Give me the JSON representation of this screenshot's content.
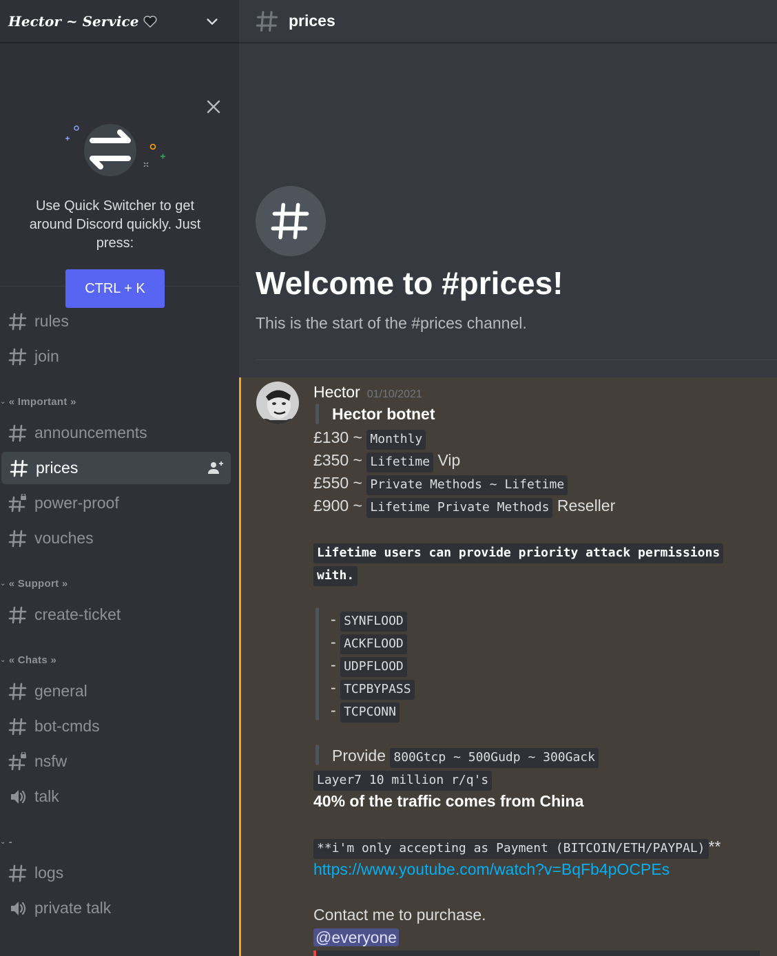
{
  "server": {
    "name": "Hector ~ Service"
  },
  "quick_switcher": {
    "text": "Use Quick Switcher to get around Discord quickly. Just press:",
    "button": "CTRL + K"
  },
  "channels": {
    "top": [
      {
        "name": "rules",
        "icon": "hash-icon"
      },
      {
        "name": "join",
        "icon": "hash-icon"
      }
    ],
    "important": {
      "label": "« Important »",
      "items": [
        {
          "name": "announcements",
          "icon": "hash-icon"
        },
        {
          "name": "prices",
          "icon": "hash-icon",
          "active": true
        },
        {
          "name": "power-proof",
          "icon": "hash-locked-icon"
        },
        {
          "name": "vouches",
          "icon": "hash-icon"
        }
      ]
    },
    "support": {
      "label": "« Support »",
      "items": [
        {
          "name": "create-ticket",
          "icon": "hash-icon"
        }
      ]
    },
    "chats": {
      "label": "« Chats »",
      "items": [
        {
          "name": "general",
          "icon": "hash-icon"
        },
        {
          "name": "bot-cmds",
          "icon": "hash-icon"
        },
        {
          "name": "nsfw",
          "icon": "hash-locked-icon"
        },
        {
          "name": "talk",
          "icon": "speaker-icon"
        }
      ]
    },
    "misc": {
      "label": "-",
      "items": [
        {
          "name": "logs",
          "icon": "hash-icon"
        },
        {
          "name": "private talk",
          "icon": "speaker-icon"
        }
      ]
    }
  },
  "header": {
    "channel": "prices"
  },
  "welcome": {
    "title": "Welcome to #prices!",
    "subtitle": "This is the start of the #prices channel."
  },
  "message": {
    "author": "Hector",
    "timestamp": "01/10/2021",
    "title": "Hector botnet",
    "price_1": "£130 ~",
    "code_1": "Monthly",
    "price_2": "£350 ~",
    "code_2": "Lifetime",
    "suffix_2": "Vip",
    "price_3": "£550  ~",
    "code_3": "Private Methods ~ Lifetime",
    "price_4": "£900 ~",
    "code_4": "Lifetime Private Methods",
    "suffix_4": "Reseller",
    "notice_a": "Lifetime users can provide priority attack permissions",
    "notice_b": "with.",
    "methods": [
      "SYNFLOOD",
      "ACKFLOOD",
      "UDPFLOOD",
      "TCPBYPASS",
      "TCPCONN"
    ],
    "provide_label": "Provide",
    "provide_code": "800Gtcp ~ 500Gudp ~ 300Gack",
    "layer7": "Layer7 10 million r/q's",
    "traffic": "40% of the traffic comes from China",
    "payment": "**i'm only accepting as Payment (BITCOIN/ETH/PAYPAL)",
    "payment_tail": "**",
    "link": "https://www.youtube.com/watch?v=BqFb4pOCPEs",
    "contact": "Contact me to purchase.",
    "mention": "@everyone"
  },
  "colors": {
    "accent": "#5865f2",
    "highlight_border": "#faa81a",
    "link": "#00aff4"
  }
}
